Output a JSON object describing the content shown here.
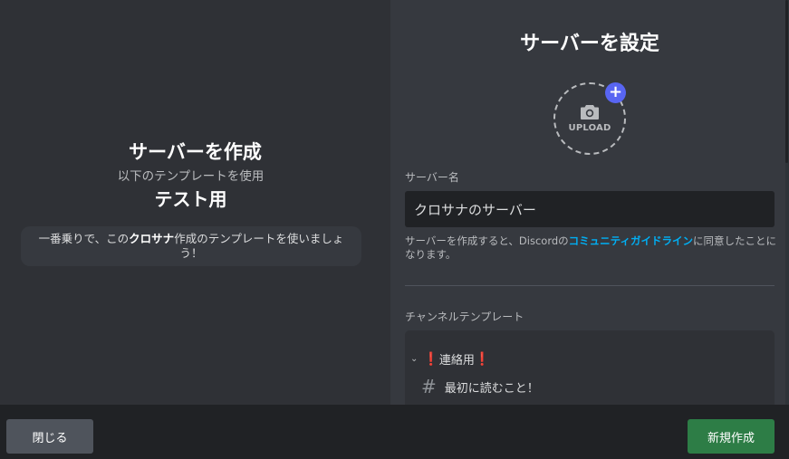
{
  "left": {
    "title": "サーバーを作成",
    "subtitle": "以下のテンプレートを使用",
    "template_name": "テスト用",
    "desc_prefix": "一番乗りで、この",
    "desc_author": "クロサナ",
    "desc_suffix": "作成のテンプレートを使いましょう！"
  },
  "right": {
    "title": "サーバーを設定",
    "upload_label": "UPLOAD",
    "upload_plus": "+",
    "server_name_label": "サーバー名",
    "server_name_value": "クロサナのサーバー",
    "terms_prefix": "サーバーを作成すると、Discordの",
    "terms_link": "コミュニティガイドライン",
    "terms_suffix": "に同意したことになります。",
    "channel_template_label": "チャンネルテンプレート",
    "category_chevron": "⌄",
    "category_excl_left": "❗",
    "category_name": "連絡用",
    "category_excl_right": "❗",
    "channel_hash": "#",
    "channel_name": "最初に読むこと！"
  },
  "footer": {
    "close_label": "閉じる",
    "create_label": "新規作成"
  },
  "colors": {
    "accent": "#5865f2",
    "create_button": "#2d7d46",
    "link": "#00aff4"
  }
}
